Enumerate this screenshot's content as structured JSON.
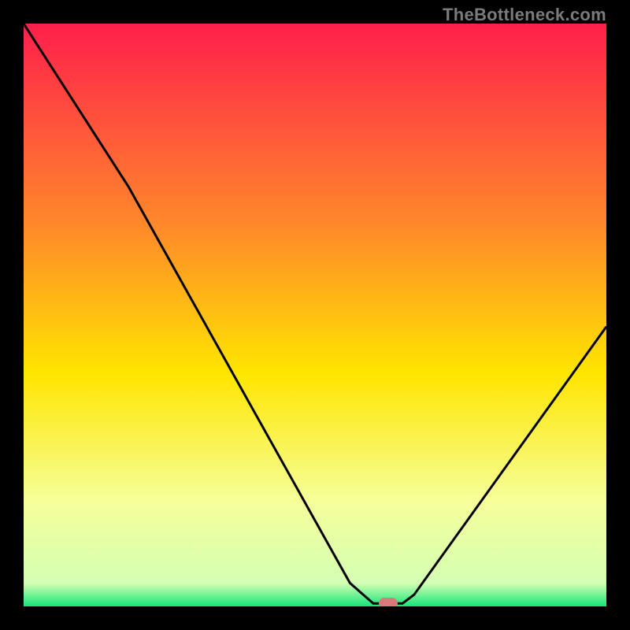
{
  "watermark": "TheBottleneck.com",
  "colors": {
    "top": "#ff1f4b",
    "mid_upper": "#ff8a2a",
    "mid": "#ffe500",
    "lower": "#f6ff9a",
    "bottom": "#17e57a",
    "curve": "#000000",
    "marker": "#d97a7a"
  },
  "chart_data": {
    "type": "line",
    "title": "",
    "xlabel": "",
    "ylabel": "",
    "xlim": [
      0,
      100
    ],
    "ylim": [
      0,
      100
    ],
    "series": [
      {
        "name": "bottleneck-curve",
        "x": [
          0,
          18,
          56,
          60,
          65,
          67,
          100
        ],
        "values": [
          100,
          72,
          4,
          0.5,
          0.5,
          2,
          48
        ]
      }
    ],
    "marker": {
      "x": 62.5,
      "y": 0.5
    },
    "gradient_stops": [
      {
        "pct": 0,
        "color": "#ff1f4b"
      },
      {
        "pct": 35,
        "color": "#ff8a2a"
      },
      {
        "pct": 60,
        "color": "#ffe500"
      },
      {
        "pct": 82,
        "color": "#f6ff9a"
      },
      {
        "pct": 96,
        "color": "#d4ffb3"
      },
      {
        "pct": 100,
        "color": "#17e57a"
      }
    ]
  }
}
